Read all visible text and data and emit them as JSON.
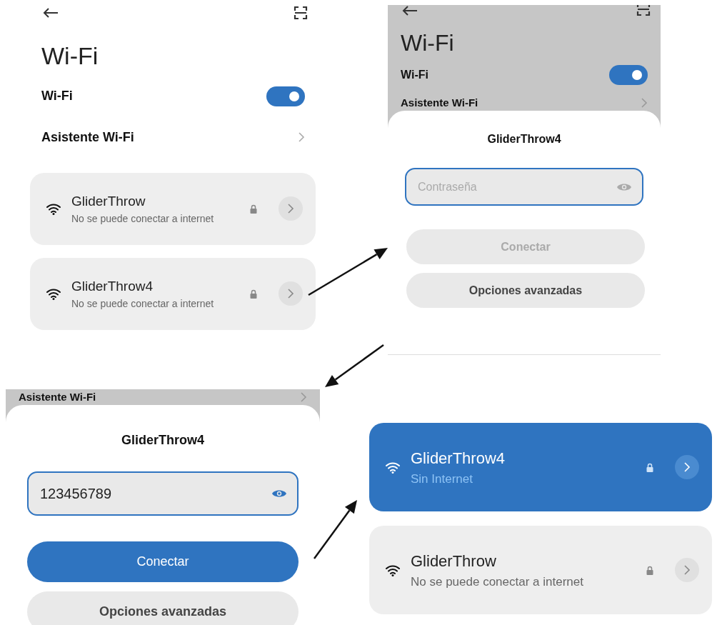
{
  "screens": [
    {
      "kind": "settings",
      "title": "Wi-Fi",
      "toggle": {
        "label": "Wi-Fi",
        "on": true
      },
      "assistant": "Asistente Wi-Fi",
      "networks": [
        {
          "name": "GliderThrow",
          "status": "No se puede conectar a internet",
          "selected": false
        },
        {
          "name": "GliderThrow4",
          "status": "No se puede conectar a internet",
          "selected": false
        }
      ]
    },
    {
      "kind": "dialog",
      "background": {
        "title": "Wi-Fi",
        "toggle": {
          "label": "Wi-Fi",
          "on": true
        },
        "assistant": "Asistente Wi-Fi"
      },
      "dialog": {
        "title": "GliderThrow4",
        "password": {
          "placeholder": "Contraseña",
          "eye_active": false
        },
        "buttons": [
          {
            "label": "Conectar",
            "primary": false,
            "disabled": true
          },
          {
            "label": "Opciones avanzadas",
            "primary": false,
            "disabled": false
          }
        ]
      }
    },
    {
      "kind": "dialog",
      "background": {
        "assistant": "Asistente Wi-Fi"
      },
      "dialog": {
        "title": "GliderThrow4",
        "password": {
          "value": "123456789",
          "eye_active": true
        },
        "buttons": [
          {
            "label": "Conectar",
            "primary": true,
            "disabled": false
          },
          {
            "label": "Opciones avanzadas",
            "primary": false,
            "disabled": false
          }
        ]
      }
    },
    {
      "kind": "list",
      "networks": [
        {
          "name": "GliderThrow4",
          "status": "Sin Internet",
          "selected": true
        },
        {
          "name": "GliderThrow",
          "status": "No se puede conectar a internet",
          "selected": false
        }
      ]
    }
  ]
}
